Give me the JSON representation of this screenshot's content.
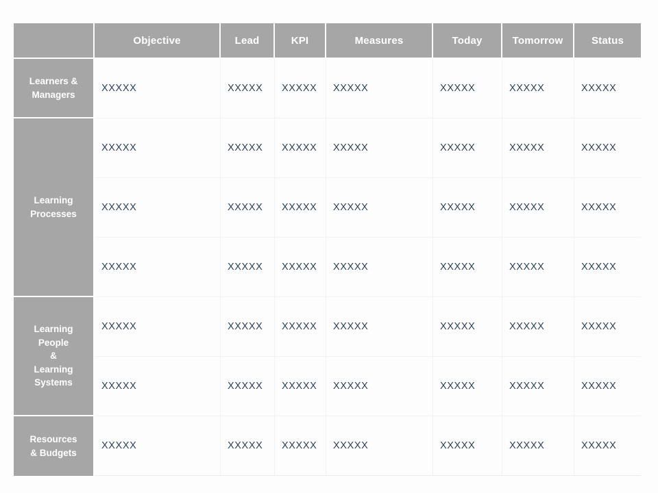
{
  "table": {
    "columns": [
      {
        "key": "perspective",
        "label": ""
      },
      {
        "key": "objective",
        "label": "Objective"
      },
      {
        "key": "lead",
        "label": "Lead"
      },
      {
        "key": "kpi",
        "label": "KPI"
      },
      {
        "key": "measures",
        "label": "Measures"
      },
      {
        "key": "today",
        "label": "Today"
      },
      {
        "key": "tomorrow",
        "label": "Tomorrow"
      },
      {
        "key": "status",
        "label": "Status"
      }
    ],
    "row_groups": [
      {
        "label_lines": [
          "Learners &",
          "Managers"
        ],
        "row_count": 1,
        "rows": [
          {
            "objective": "XXXXX",
            "lead": "XXXXX",
            "kpi": "XXXXX",
            "measures": "XXXXX",
            "today": "XXXXX",
            "tomorrow": "XXXXX",
            "status": "XXXXX"
          }
        ]
      },
      {
        "label_lines": [
          "Learning",
          "Processes"
        ],
        "row_count": 3,
        "rows": [
          {
            "objective": "XXXXX",
            "lead": "XXXXX",
            "kpi": "XXXXX",
            "measures": "XXXXX",
            "today": "XXXXX",
            "tomorrow": "XXXXX",
            "status": "XXXXX"
          },
          {
            "objective": "XXXXX",
            "lead": "XXXXX",
            "kpi": "XXXXX",
            "measures": "XXXXX",
            "today": "XXXXX",
            "tomorrow": "XXXXX",
            "status": "XXXXX"
          },
          {
            "objective": "XXXXX",
            "lead": "XXXXX",
            "kpi": "XXXXX",
            "measures": "XXXXX",
            "today": "XXXXX",
            "tomorrow": "XXXXX",
            "status": "XXXXX"
          }
        ]
      },
      {
        "label_lines": [
          "Learning",
          "People",
          "&",
          "Learning",
          "Systems"
        ],
        "row_count": 2,
        "rows": [
          {
            "objective": "XXXXX",
            "lead": "XXXXX",
            "kpi": "XXXXX",
            "measures": "XXXXX",
            "today": "XXXXX",
            "tomorrow": "XXXXX",
            "status": "XXXXX"
          },
          {
            "objective": "XXXXX",
            "lead": "XXXXX",
            "kpi": "XXXXX",
            "measures": "XXXXX",
            "today": "XXXXX",
            "tomorrow": "XXXXX",
            "status": "XXXXX"
          }
        ]
      },
      {
        "label_lines": [
          "Resources",
          "& Budgets"
        ],
        "row_count": 1,
        "rows": [
          {
            "objective": "XXXXX",
            "lead": "XXXXX",
            "kpi": "XXXXX",
            "measures": "XXXXX",
            "today": "XXXXX",
            "tomorrow": "XXXXX",
            "status": "XXXXX"
          }
        ]
      }
    ]
  },
  "colors": {
    "header_gray": "#a6a6a6",
    "header_text": "#ffffff",
    "cell_text": "#2e4257",
    "page_background": "#fdfdfe",
    "grid_line": "#f1f2f4"
  }
}
